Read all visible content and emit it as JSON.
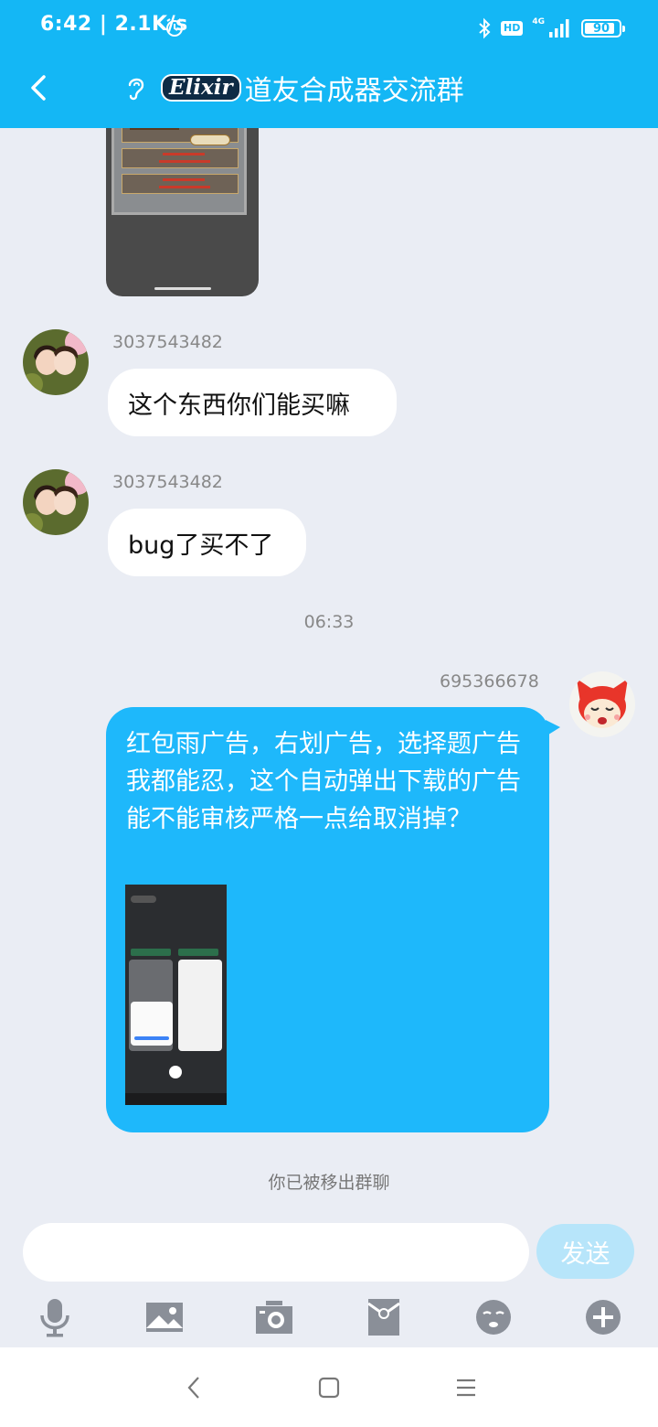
{
  "status_bar": {
    "time_speed": "6:42 | 2.1K/s",
    "hd": "HD",
    "network": "4G",
    "battery": "90",
    "battery_level": 0.9
  },
  "header": {
    "back_icon": "chevron-left-icon",
    "ear_icon": "ear-icon",
    "logo_text": "Elixir",
    "title": "道友合成器交流群"
  },
  "messages": [
    {
      "type": "image",
      "side": "left",
      "desc": "game screenshot"
    },
    {
      "type": "text",
      "side": "left",
      "sender": "3037543482",
      "text": "这个东西你们能买嘛"
    },
    {
      "type": "text",
      "side": "left",
      "sender": "3037543482",
      "text": "bug了买不了"
    },
    {
      "type": "time",
      "text": "06:33"
    },
    {
      "type": "text_image",
      "side": "right",
      "sender": "695366678",
      "text": "红包雨广告，右划广告，选择题广告我都能忍，这个自动弹出下载的广告能不能审核严格一点给取消掉？"
    }
  ],
  "notice": "你已被移出群聊",
  "input": {
    "placeholder": "",
    "send_label": "发送"
  },
  "toolbar": [
    "microphone-icon",
    "image-icon",
    "camera-icon",
    "red-packet-icon",
    "emoji-icon",
    "plus-icon"
  ],
  "system_nav": [
    "back-icon",
    "home-icon",
    "menu-icon"
  ],
  "colors": {
    "header": "#14B7F5",
    "background": "#EAEDF4",
    "my_bubble": "#1EB8FB",
    "send_button": "#B7E5FA"
  }
}
